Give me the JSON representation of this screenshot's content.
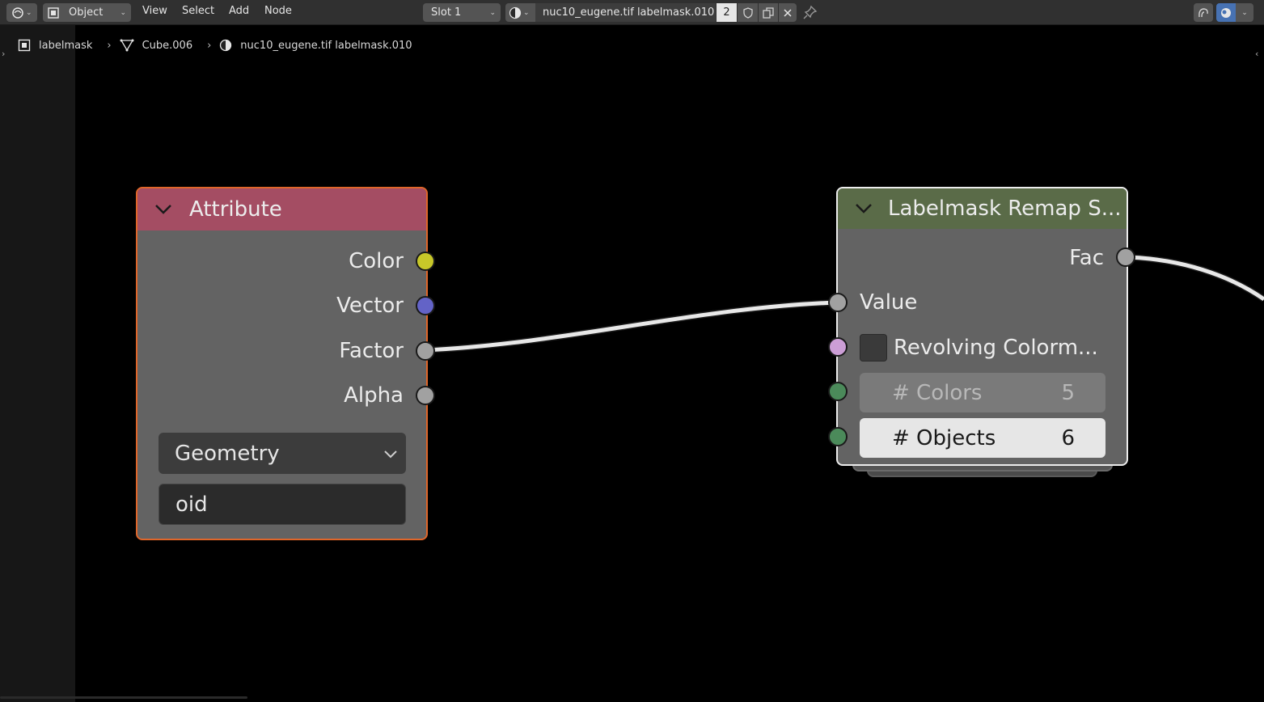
{
  "header": {
    "mode_label": "Object",
    "menus": [
      "View",
      "Select",
      "Add",
      "Node"
    ],
    "slot_label": "Slot 1",
    "material_name": "nuc10_eugene.tif labelmask.010",
    "user_count": "2"
  },
  "breadcrumb": {
    "object": "labelmask",
    "mesh": "Cube.006",
    "material": "nuc10_eugene.tif labelmask.010"
  },
  "attribute_node": {
    "title": "Attribute",
    "outputs": [
      "Color",
      "Vector",
      "Factor",
      "Alpha"
    ],
    "type_value": "Geometry",
    "name_value": "oid"
  },
  "remap_node": {
    "title": "Labelmask Remap S...",
    "output": "Fac",
    "inputs": {
      "value": "Value",
      "colormap": "Revolving Colorm...",
      "colors_label": "# Colors",
      "colors_value": "5",
      "objects_label": "# Objects",
      "objects_value": "6"
    }
  },
  "colors": {
    "attribute_header": "#a44d63",
    "attribute_border": "#e0662a",
    "remap_header": "#5a6b48",
    "socket_color": "#c7c729",
    "socket_vector": "#6363c7",
    "socket_float": "#a1a1a1",
    "socket_shader": "#cc9ed6",
    "socket_int": "#4b8a5a"
  }
}
